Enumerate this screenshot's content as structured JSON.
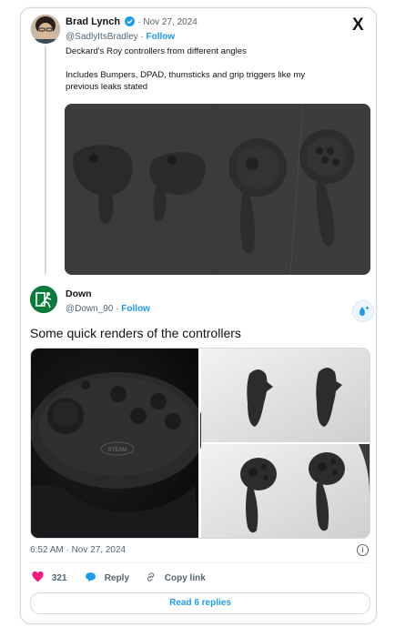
{
  "quoted": {
    "author_name": "Brad Lynch",
    "date": "· Nov 27, 2024",
    "handle": "@SadlyItsBradley",
    "follow": "Follow",
    "text_line1": "Deckard's Roy controllers from different angles",
    "text_line2": "Includes Bumpers, DPAD, thumsticks and grip triggers like my",
    "text_line3": "previous leaks stated",
    "verified_icon": "verified-badge-icon",
    "platform_logo": "X"
  },
  "tweet": {
    "author_name": "Down",
    "handle": "@Down_90",
    "follow": "Follow",
    "text": "Some quick renders of the controllers",
    "steam_label": "STEAM",
    "timestamp": "6:52 AM · Nov 27, 2024",
    "likes": "321",
    "reply_label": "Reply",
    "copy_label": "Copy link",
    "read_replies": "Read 6 replies"
  },
  "colors": {
    "accent": "#1d9bf0",
    "like": "#f91880",
    "muted": "#536471",
    "border": "#cfd9de"
  }
}
